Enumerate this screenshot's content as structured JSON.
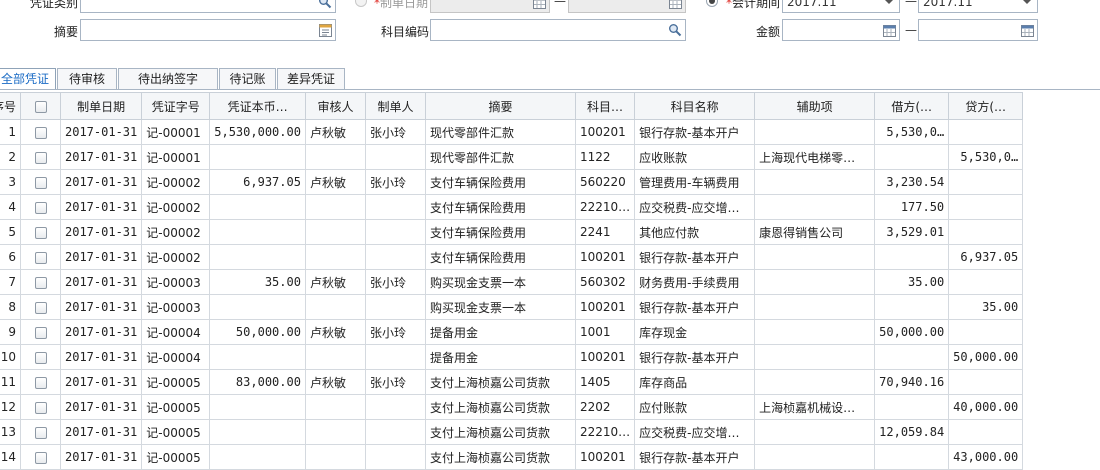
{
  "filters": {
    "voucher_type_label": "凭证类别",
    "create_date_label": "制单日期",
    "date_separator": "—",
    "period_label": "会计期间",
    "period_from": "2017.11",
    "period_to": "2017.11",
    "summary_label": "摘要",
    "subject_code_label": "科目编码",
    "amount_label": "金额",
    "amount_separator": "—",
    "required_mark": "*"
  },
  "tabs": [
    {
      "label": "全部凭证",
      "active": true
    },
    {
      "label": "待审核",
      "active": false
    },
    {
      "label": "待出纳签字",
      "active": false
    },
    {
      "label": "待记账",
      "active": false
    },
    {
      "label": "差异凭证",
      "active": false
    }
  ],
  "table": {
    "columns": [
      "序号",
      "",
      "制单日期",
      "凭证字号",
      "凭证本币…",
      "审核人",
      "制单人",
      "摘要",
      "科目…",
      "科目名称",
      "辅助项",
      "借方(…",
      "贷方(…"
    ],
    "rows": [
      {
        "no": "1",
        "date": "2017-01-31",
        "voucher": "记-00001",
        "amount": "5,530,000.00",
        "auditor": "卢秋敏",
        "maker": "张小玲",
        "summary": "现代零部件汇款",
        "code": "100201",
        "name": "银行存款-基本开户",
        "aux": "",
        "debit": "5,530,0…",
        "credit": ""
      },
      {
        "no": "2",
        "date": "2017-01-31",
        "voucher": "记-00001",
        "amount": "",
        "auditor": "",
        "maker": "",
        "summary": "现代零部件汇款",
        "code": "1122",
        "name": "应收账款",
        "aux": "上海现代电梯零…",
        "debit": "",
        "credit": "5,530,0…"
      },
      {
        "no": "3",
        "date": "2017-01-31",
        "voucher": "记-00002",
        "amount": "6,937.05",
        "auditor": "卢秋敏",
        "maker": "张小玲",
        "summary": "支付车辆保险费用",
        "code": "560220",
        "name": "管理费用-车辆费用",
        "aux": "",
        "debit": "3,230.54",
        "credit": ""
      },
      {
        "no": "4",
        "date": "2017-01-31",
        "voucher": "记-00002",
        "amount": "",
        "auditor": "",
        "maker": "",
        "summary": "支付车辆保险费用",
        "code": "22210…",
        "name": "应交税费-应交增…",
        "aux": "",
        "debit": "177.50",
        "credit": ""
      },
      {
        "no": "5",
        "date": "2017-01-31",
        "voucher": "记-00002",
        "amount": "",
        "auditor": "",
        "maker": "",
        "summary": "支付车辆保险费用",
        "code": "2241",
        "name": "其他应付款",
        "aux": "康恩得销售公司",
        "debit": "3,529.01",
        "credit": ""
      },
      {
        "no": "6",
        "date": "2017-01-31",
        "voucher": "记-00002",
        "amount": "",
        "auditor": "",
        "maker": "",
        "summary": "支付车辆保险费用",
        "code": "100201",
        "name": "银行存款-基本开户",
        "aux": "",
        "debit": "",
        "credit": "6,937.05"
      },
      {
        "no": "7",
        "date": "2017-01-31",
        "voucher": "记-00003",
        "amount": "35.00",
        "auditor": "卢秋敏",
        "maker": "张小玲",
        "summary": "购买现金支票一本",
        "code": "560302",
        "name": "财务费用-手续费用",
        "aux": "",
        "debit": "35.00",
        "credit": ""
      },
      {
        "no": "8",
        "date": "2017-01-31",
        "voucher": "记-00003",
        "amount": "",
        "auditor": "",
        "maker": "",
        "summary": "购买现金支票一本",
        "code": "100201",
        "name": "银行存款-基本开户",
        "aux": "",
        "debit": "",
        "credit": "35.00"
      },
      {
        "no": "9",
        "date": "2017-01-31",
        "voucher": "记-00004",
        "amount": "50,000.00",
        "auditor": "卢秋敏",
        "maker": "张小玲",
        "summary": "提备用金",
        "code": "1001",
        "name": "库存现金",
        "aux": "",
        "debit": "50,000.00",
        "credit": ""
      },
      {
        "no": "10",
        "date": "2017-01-31",
        "voucher": "记-00004",
        "amount": "",
        "auditor": "",
        "maker": "",
        "summary": "提备用金",
        "code": "100201",
        "name": "银行存款-基本开户",
        "aux": "",
        "debit": "",
        "credit": "50,000.00"
      },
      {
        "no": "11",
        "date": "2017-01-31",
        "voucher": "记-00005",
        "amount": "83,000.00",
        "auditor": "卢秋敏",
        "maker": "张小玲",
        "summary": "支付上海桢嘉公司货款",
        "code": "1405",
        "name": "库存商品",
        "aux": "",
        "debit": "70,940.16",
        "credit": ""
      },
      {
        "no": "12",
        "date": "2017-01-31",
        "voucher": "记-00005",
        "amount": "",
        "auditor": "",
        "maker": "",
        "summary": "支付上海桢嘉公司货款",
        "code": "2202",
        "name": "应付账款",
        "aux": "上海桢嘉机械设…",
        "debit": "",
        "credit": "40,000.00"
      },
      {
        "no": "13",
        "date": "2017-01-31",
        "voucher": "记-00005",
        "amount": "",
        "auditor": "",
        "maker": "",
        "summary": "支付上海桢嘉公司货款",
        "code": "22210…",
        "name": "应交税费-应交增…",
        "aux": "",
        "debit": "12,059.84",
        "credit": ""
      },
      {
        "no": "14",
        "date": "2017-01-31",
        "voucher": "记-00005",
        "amount": "",
        "auditor": "",
        "maker": "",
        "summary": "支付上海桢嘉公司货款",
        "code": "100201",
        "name": "银行存款-基本开户",
        "aux": "",
        "debit": "",
        "credit": "43,000.00"
      }
    ]
  },
  "icons": {
    "lookup": "magnifier-icon",
    "calendar": "calendar-icon",
    "dropdown": "chevron-down-icon",
    "picker": "list-picker-icon"
  },
  "colors": {
    "active_tab": "#1a6bc5",
    "required": "#e0302a",
    "border": "#a8b5c4"
  }
}
